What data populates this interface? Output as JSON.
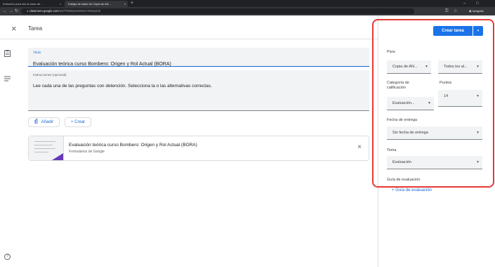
{
  "browser": {
    "tabs": [
      {
        "label": "Invitación para dar la clase de ...",
        "close": "×"
      },
      {
        "label": "Trabajo de clase de Copia de AN...",
        "close": "×"
      }
    ],
    "new_tab": "+",
    "window_controls": [
      "–",
      "□"
    ],
    "url_domain": "classroom.google.com",
    "url_path": "/u/4/T/NDEyNzMzNzY2MzQ4/a/",
    "incognito_label": "Incógnito"
  },
  "header": {
    "close": "×",
    "title": "Tarea"
  },
  "main": {
    "title_label": "Título",
    "title_value": "Evaluación teórica curso Bombero: Origen y Rol Actual (BORA)",
    "instructions_label": "Instrucciones (opcional)",
    "instructions_value": "Lee cada una de las preguntas con detención. Selecciona la o las alternativas correctas.",
    "add_button": "Añadir",
    "add_icon": "paperclip-icon",
    "create_button": "+ Crear",
    "attachment": {
      "title": "Evaluación teórica curso Bombero: Origen y Rol Actual (BORA)",
      "subtitle": "Formularios de Google",
      "remove": "×"
    },
    "help": "?"
  },
  "sidebar_icons": [
    "assignment-icon",
    "notes-icon"
  ],
  "right_panel": {
    "assign_button": "Crear tarea",
    "assign_menu": "▾",
    "for_label": "Para",
    "class_value": "Copia de AN...",
    "students_value": "Todos los al...",
    "grade_category_label": "Categoría de calificación",
    "grade_category_value": "Evaluación...",
    "points_label": "Puntos",
    "points_value": "14",
    "due_label": "Fecha de entrega",
    "due_value": "Sin fecha de entrega",
    "topic_label": "Tema",
    "topic_value": "Evaluación",
    "rubric_label": "Guía de evaluación",
    "add_rubric": "+  Guía de evaluación"
  },
  "colors": {
    "accent": "#1a73e8",
    "highlight": "#e53935",
    "form_purple": "#673ab7"
  }
}
